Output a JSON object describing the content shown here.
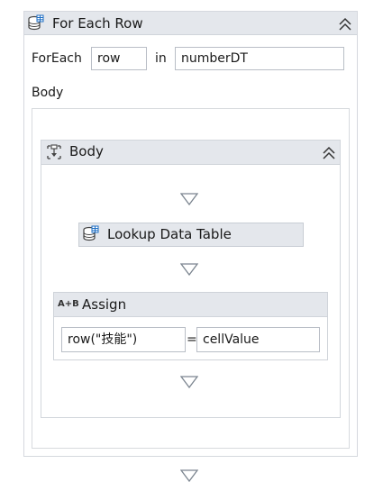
{
  "foreach": {
    "title": "For Each Row",
    "foreach_label": "ForEach",
    "item_variable": "row",
    "in_label": "in",
    "collection": "numberDT",
    "body_label": "Body"
  },
  "sequence": {
    "title": "Body"
  },
  "lookup": {
    "title": "Lookup Data Table"
  },
  "assign": {
    "title": "Assign",
    "icon_text": "A+B",
    "to": "row(\"技能\")",
    "equals": "=",
    "value": "cellValue"
  },
  "icons": {
    "foreach": "database-icon",
    "sequence": "sequence-icon",
    "lookup": "database-icon",
    "assign": "assign-icon",
    "collapse": "double-chevron-up-icon",
    "drop": "drop-target-arrow-icon"
  }
}
